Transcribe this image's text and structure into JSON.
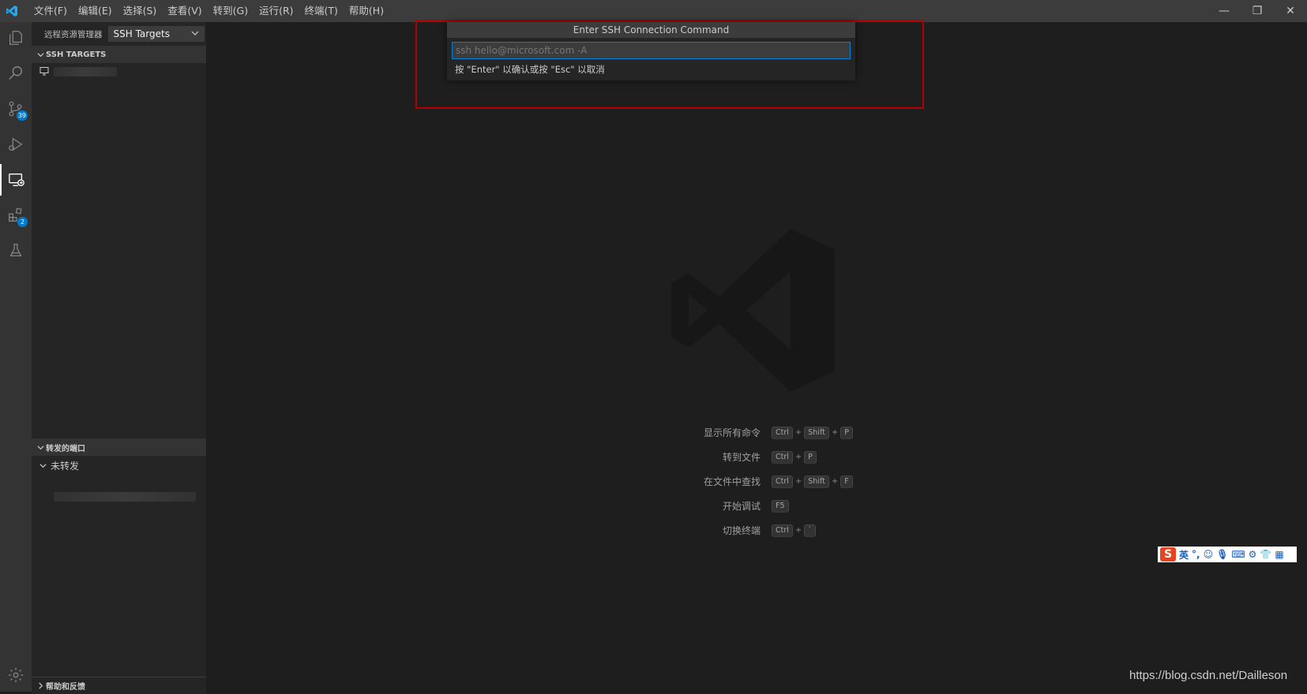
{
  "menu": {
    "items": [
      "文件(F)",
      "编辑(E)",
      "选择(S)",
      "查看(V)",
      "转到(G)",
      "运行(R)",
      "终端(T)",
      "帮助(H)"
    ]
  },
  "window_controls": {
    "minimize": "—",
    "restore": "❐",
    "close": "✕"
  },
  "activity": {
    "source_control_badge": "39",
    "extensions_badge": "2"
  },
  "sidebar": {
    "title": "远程资源管理器",
    "select_value": "SSH Targets",
    "section_ssh": "SSH TARGETS",
    "section_ports": "转发的端口",
    "ports_group": "未转发",
    "section_help": "帮助和反馈"
  },
  "quick_input": {
    "title": "Enter SSH Connection Command",
    "placeholder": "ssh hello@microsoft.com -A",
    "hint": "按 \"Enter\" 以确认或按 \"Esc\" 以取消"
  },
  "shortcuts": [
    {
      "label": "显示所有命令",
      "keys": [
        "Ctrl",
        "Shift",
        "P"
      ]
    },
    {
      "label": "转到文件",
      "keys": [
        "Ctrl",
        "P"
      ]
    },
    {
      "label": "在文件中查找",
      "keys": [
        "Ctrl",
        "Shift",
        "F"
      ]
    },
    {
      "label": "开始调试",
      "keys": [
        "F5"
      ]
    },
    {
      "label": "切换终端",
      "keys": [
        "Ctrl",
        "`"
      ]
    }
  ],
  "ime": {
    "logo": "S",
    "mode": "英"
  },
  "footer_watermark": "https://blog.csdn.net/Dailleson",
  "colors": {
    "accent": "#007acc",
    "highlight_box": "#b30000",
    "ime_logo": "#e8431f"
  }
}
